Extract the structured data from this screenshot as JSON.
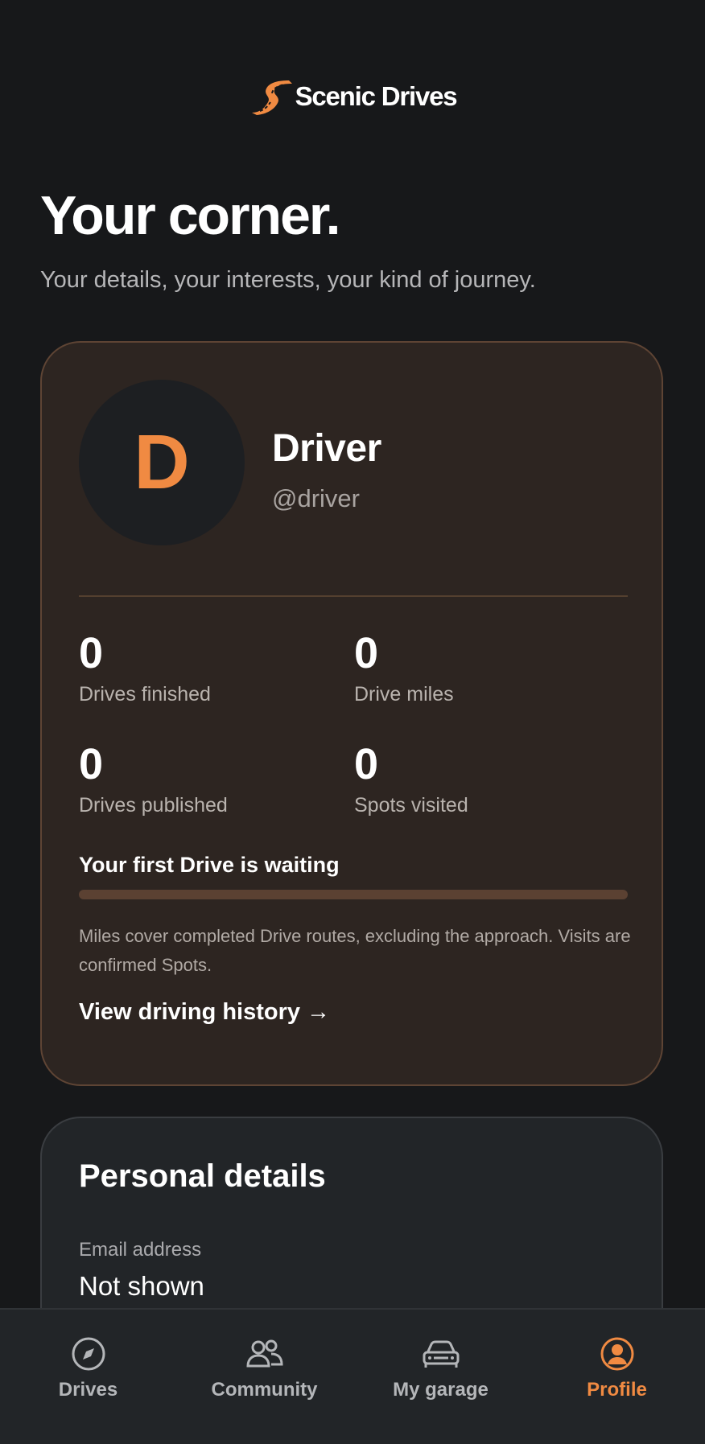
{
  "brand": {
    "name": "Scenic Drives",
    "accent": "#f08a42"
  },
  "hero": {
    "title": "Your corner.",
    "subtitle": "Your details, your interests, your kind of journey."
  },
  "profile": {
    "initial": "D",
    "display_name": "Driver",
    "handle": "@driver",
    "stats": [
      {
        "value": "0",
        "label": "Drives finished"
      },
      {
        "value": "0",
        "label": "Drive miles"
      },
      {
        "value": "0",
        "label": "Drives published"
      },
      {
        "value": "0",
        "label": "Spots visited"
      }
    ],
    "progress_title": "Your first Drive is waiting",
    "progress_fraction": 0,
    "note": "Miles cover completed Drive routes, excluding the approach. Visits are confirmed Spots.",
    "history_link": "View driving history",
    "history_arrow": "→"
  },
  "details": {
    "title": "Personal details",
    "email_label": "Email address",
    "email_value": "Not shown"
  },
  "tabs": [
    {
      "label": "Drives",
      "icon": "compass-icon",
      "active": false
    },
    {
      "label": "Community",
      "icon": "people-icon",
      "active": false
    },
    {
      "label": "My garage",
      "icon": "car-icon",
      "active": false
    },
    {
      "label": "Profile",
      "icon": "user-circle-icon",
      "active": true
    }
  ]
}
